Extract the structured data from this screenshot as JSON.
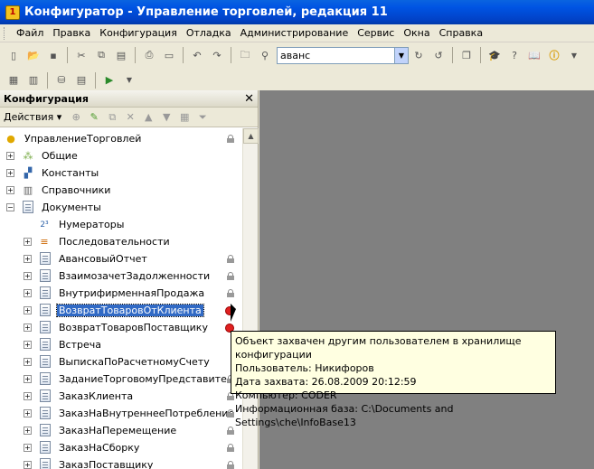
{
  "window": {
    "title": "Конфигуратор - Управление торговлей, редакция 11"
  },
  "menu": [
    "Файл",
    "Правка",
    "Конфигурация",
    "Отладка",
    "Администрирование",
    "Сервис",
    "Окна",
    "Справка"
  ],
  "search": {
    "value": "аванс"
  },
  "panel": {
    "title": "Конфигурация",
    "actions_label": "Действия"
  },
  "tree": [
    {
      "label": "УправлениеТорговлей",
      "icon": "config-root-icon"
    },
    {
      "label": "Общие",
      "icon": "common-icon"
    },
    {
      "label": "Константы",
      "icon": "constants-icon"
    },
    {
      "label": "Справочники",
      "icon": "catalogs-icon"
    },
    {
      "label": "Документы",
      "icon": "documents-icon"
    },
    {
      "label": "Нумераторы",
      "icon": "numerators-icon"
    },
    {
      "label": "Последовательности",
      "icon": "sequences-icon"
    },
    {
      "label": "АвансовыйОтчет",
      "icon": "document-icon"
    },
    {
      "label": "ВзаимозачетЗадолженности",
      "icon": "document-icon"
    },
    {
      "label": "ВнутрифирменнаяПродажа",
      "icon": "document-icon"
    },
    {
      "label": "ВозвратТоваровОтКлиента",
      "icon": "document-icon"
    },
    {
      "label": "ВозвратТоваровПоставщику",
      "icon": "document-icon"
    },
    {
      "label": "Встреча",
      "icon": "document-icon"
    },
    {
      "label": "ВыпискаПоРасчетномуСчету",
      "icon": "document-icon"
    },
    {
      "label": "ЗаданиеТорговомуПредставите...",
      "icon": "document-icon"
    },
    {
      "label": "ЗаказКлиента",
      "icon": "document-icon"
    },
    {
      "label": "ЗаказНаВнутреннееПотребление",
      "icon": "document-icon"
    },
    {
      "label": "ЗаказНаПеремещение",
      "icon": "document-icon"
    },
    {
      "label": "ЗаказНаСборку",
      "icon": "document-icon"
    },
    {
      "label": "ЗаказПоставщику",
      "icon": "document-icon"
    }
  ],
  "tooltip": {
    "line1": "Объект захвачен другим пользователем в хранилище конфигурации",
    "line2": "Пользователь: Никифоров",
    "line3": "Дата захвата: 26.08.2009 20:12:59",
    "line4": "Компьютер: CODER",
    "line5": "Информационная база: C:\\Documents and Settings\\che\\InfoBase13"
  }
}
